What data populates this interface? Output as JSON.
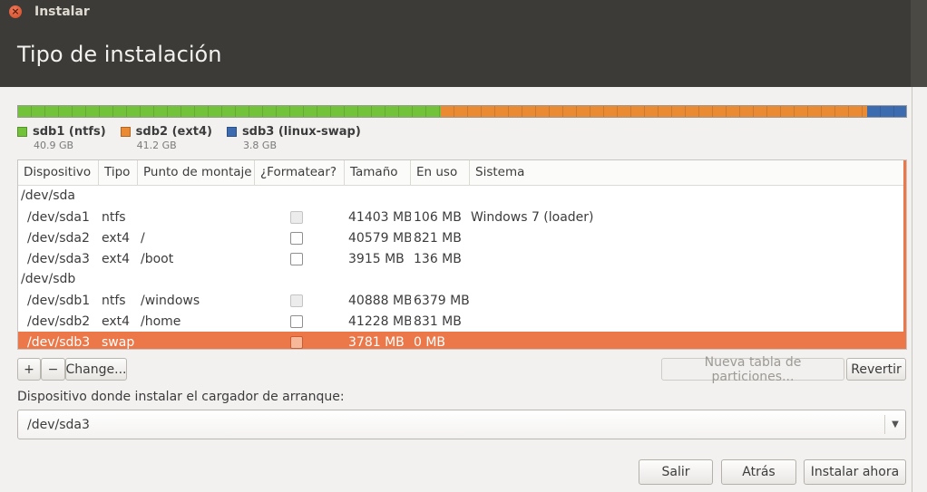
{
  "window": {
    "title": "Instalar"
  },
  "header": {
    "title": "Tipo de instalación"
  },
  "partition_bar": {
    "segments": [
      {
        "name": "sdb1 (ntfs)",
        "size": "40.9 GB",
        "color": "#73c33a"
      },
      {
        "name": "sdb2 (ext4)",
        "size": "41.2 GB",
        "color": "#ea8a32"
      },
      {
        "name": "sdb3 (linux-swap)",
        "size": "3.8 GB",
        "color": "#3c6bb0"
      }
    ]
  },
  "table": {
    "columns": [
      "Dispositivo",
      "Tipo",
      "Punto de montaje",
      "¿Formatear?",
      "Tamaño",
      "En uso",
      "Sistema"
    ],
    "groups": [
      {
        "device": "/dev/sda",
        "rows": [
          {
            "device": "/dev/sda1",
            "type": "ntfs",
            "mount": "",
            "size": "41403 MB",
            "used": "106 MB",
            "system": "Windows 7 (loader)"
          },
          {
            "device": "/dev/sda2",
            "type": "ext4",
            "mount": "/",
            "size": "40579 MB",
            "used": "821 MB",
            "system": ""
          },
          {
            "device": "/dev/sda3",
            "type": "ext4",
            "mount": "/boot",
            "size": "3915 MB",
            "used": "136 MB",
            "system": ""
          }
        ]
      },
      {
        "device": "/dev/sdb",
        "rows": [
          {
            "device": "/dev/sdb1",
            "type": "ntfs",
            "mount": "/windows",
            "size": "40888 MB",
            "used": "6379 MB",
            "system": ""
          },
          {
            "device": "/dev/sdb2",
            "type": "ext4",
            "mount": "/home",
            "size": "41228 MB",
            "used": "831 MB",
            "system": ""
          },
          {
            "device": "/dev/sdb3",
            "type": "swap",
            "mount": "",
            "size": "3781 MB",
            "used": "0 MB",
            "system": ""
          }
        ]
      }
    ]
  },
  "toolbar": {
    "add_label": "+",
    "remove_label": "−",
    "change_label": "Change...",
    "new_table_label": "Nueva tabla de particiones...",
    "revert_label": "Revertir"
  },
  "bootloader": {
    "label": "Dispositivo donde instalar el cargador de arranque:",
    "value": "/dev/sda3"
  },
  "actions": {
    "quit_label": "Salir",
    "back_label": "Atrás",
    "install_label": "Instalar ahora"
  },
  "colors": {
    "accent": "#ec784a",
    "header_bg": "#3c3b37"
  }
}
